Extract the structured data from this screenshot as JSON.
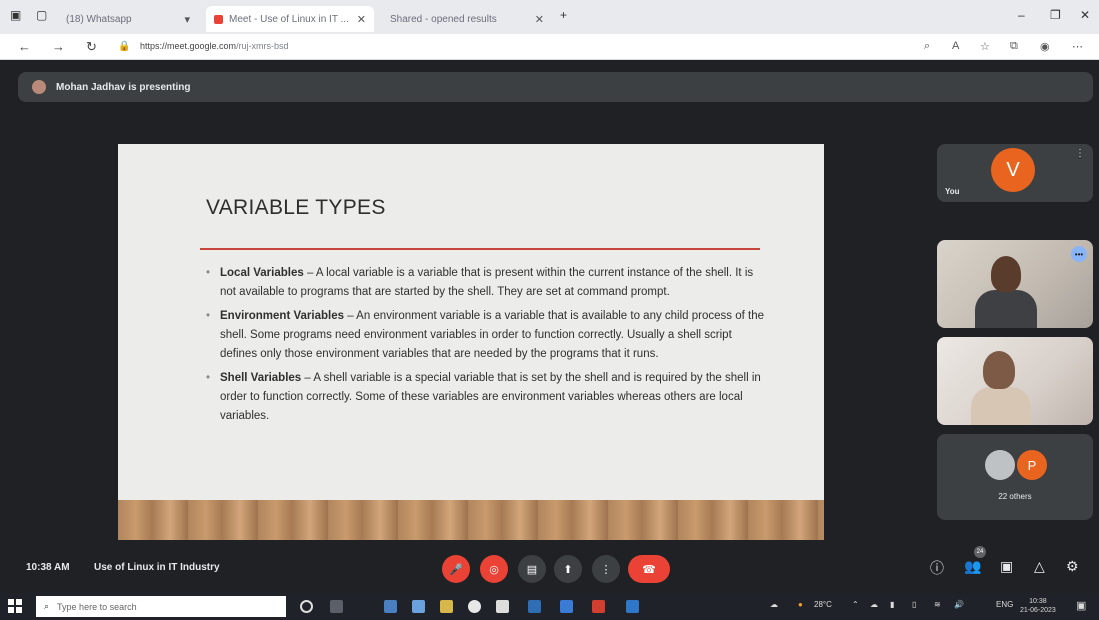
{
  "browser": {
    "tabs": [
      {
        "label": "(18) Whatsapp",
        "active": false
      },
      {
        "label": "Meet - Use of Linux in IT ...",
        "active": true
      },
      {
        "label": "Shared - opened results",
        "active": false
      }
    ],
    "new_tab": "+",
    "url_host": "https://meet.google.com",
    "url_path": "/ruj-xmrs-bsd"
  },
  "meet": {
    "presenting_text": "Mohan Jadhav is presenting",
    "time": "10:38 AM",
    "meeting_title": "Use of Linux in IT Industry",
    "participants_badge": "24",
    "tiles": {
      "you": {
        "initial": "V",
        "label": "You",
        "color": "#e8641f"
      },
      "others": {
        "initial": "P",
        "label": "22 others",
        "color": "#e8641f"
      }
    }
  },
  "slide": {
    "title": "VARIABLE TYPES",
    "bullets": [
      {
        "term": "Local Variables",
        "text": " – A local variable is a variable that is present within the current instance of the shell. It is not available to programs that are started by the shell. They are set at command prompt."
      },
      {
        "term": "Environment Variables",
        "text": " – An environment variable is a variable that is available to any child process of the shell. Some programs need environment variables in order to function correctly. Usually a shell script defines only those environment variables that are needed by the programs that it runs."
      },
      {
        "term": "Shell Variables",
        "text": " – A shell variable is a special variable that is set by the shell and is required by the shell in order to function correctly. Some of these variables are environment variables whereas others are local variables."
      }
    ]
  },
  "taskbar": {
    "search_placeholder": "Type here to search",
    "tray_temp": "28°C",
    "tray_lang": "ENG",
    "clock_time": "10:38",
    "clock_date": "21-06-2023"
  },
  "colors": {
    "meet_bg": "#202124",
    "tile_bg": "#3c4043",
    "accent_red": "#ea4335",
    "slide_rule": "#c4463d",
    "avatar_orange": "#e8641f"
  }
}
